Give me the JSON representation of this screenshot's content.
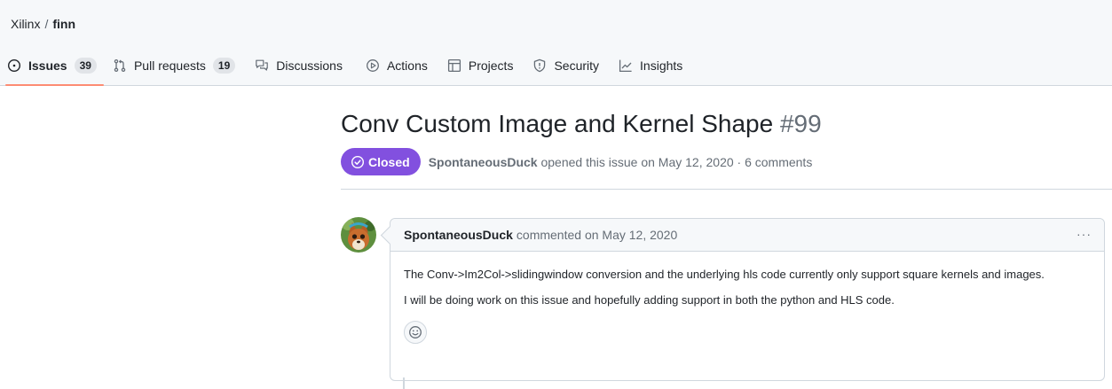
{
  "breadcrumb": {
    "owner": "Xilinx",
    "separator": "/",
    "repo": "finn"
  },
  "tabs": [
    {
      "label": "Issues",
      "count": "39",
      "icon": "issue-opened-icon",
      "active": true
    },
    {
      "label": "Pull requests",
      "count": "19",
      "icon": "git-pull-request-icon"
    },
    {
      "label": "Discussions",
      "icon": "comment-discussion-icon"
    },
    {
      "label": "Actions",
      "icon": "play-icon"
    },
    {
      "label": "Projects",
      "icon": "table-icon"
    },
    {
      "label": "Security",
      "icon": "shield-icon"
    },
    {
      "label": "Insights",
      "icon": "graph-icon"
    }
  ],
  "issue": {
    "title": "Conv Custom Image and Kernel Shape",
    "number": "#99",
    "state": "Closed",
    "author": "SpontaneousDuck",
    "opened_text": "opened this issue on May 12, 2020 · 6 comments"
  },
  "comment": {
    "author": "SpontaneousDuck",
    "action_text": "commented on May 12, 2020",
    "menu_label": "···",
    "paragraphs": [
      "The Conv->Im2Col->slidingwindow conversion and the underlying hls code currently only support square kernels and images.",
      "I will be doing work on this issue and hopefully adding support in both the python and HLS code."
    ]
  },
  "colors": {
    "closed_badge": "#8250df",
    "active_tab_underline": "#fd8c73"
  }
}
